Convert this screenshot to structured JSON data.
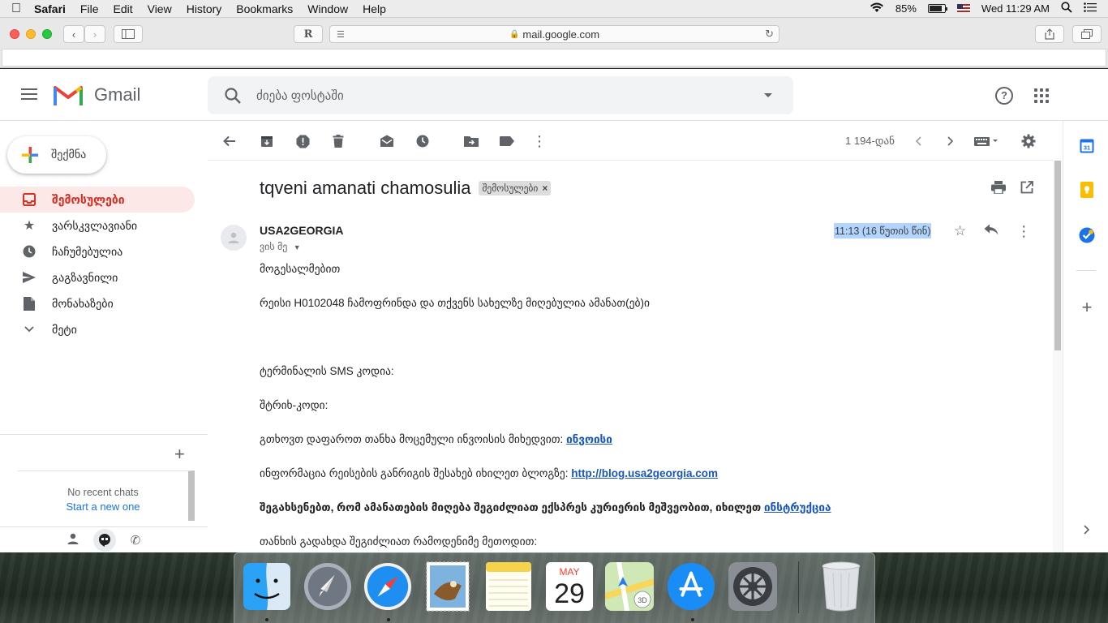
{
  "menubar": {
    "app": "Safari",
    "items": [
      "File",
      "Edit",
      "View",
      "History",
      "Bookmarks",
      "Window",
      "Help"
    ],
    "battery": "85%",
    "clock": "Wed 11:29 AM"
  },
  "safari": {
    "url": "mail.google.com",
    "reader_label": "R"
  },
  "gmail": {
    "logo_text": "Gmail",
    "search_placeholder": "ძიება ფოსტაში",
    "compose_label": "შექმნა",
    "nav": [
      {
        "label": "შემოსულები",
        "icon": "inbox-icon",
        "active": true
      },
      {
        "label": "ვარსკვლავიანი",
        "icon": "star-icon"
      },
      {
        "label": "ჩაჩუმებულია",
        "icon": "clock-icon"
      },
      {
        "label": "გაგზავნილი",
        "icon": "send-icon"
      },
      {
        "label": "მონახაზები",
        "icon": "draft-icon"
      },
      {
        "label": "მეტი",
        "icon": "chevron-down-icon"
      }
    ],
    "chat": {
      "no_recent": "No recent chats",
      "start_new": "Start a new one"
    },
    "pagination": "1 194-დან",
    "email": {
      "subject": "tqveni amanati chamosulia",
      "label_chip": "შემოსულები",
      "sender": "USA2GEORGIA",
      "to": "ვის მე",
      "time": "11:13 (16 წუთის წინ)",
      "lines": {
        "greeting": "მოგესალმებით",
        "flight": "რეისი H0102048 ჩამოფრინდა და თქვენს სახელზე მიღებულია ამანათ(ებ)ი",
        "sms": "ტერმინალის SMS კოდია:",
        "barcode": "შტრიხ-კოდი:",
        "invoice_text": "გთხოვთ დაფაროთ თანხა მოცემული ინვოისის მიხედვით: ",
        "invoice_link": "ინვოისი",
        "info_text": "ინფორმაცია რეისების განრიგის შესახებ იხილეთ ბლოგზე: ",
        "info_link": "http://blog.usa2georgia.com",
        "courier_text": "შეგახსენებთ, რომ ამანათების მიღება შეგიძლიათ ექსპრეს კურიერის მეშვეობით, იხილეთ ",
        "courier_link": "ინსტრუქცია",
        "payment": "თანხის გადახდა შეგიძლიათ რამოდენიმე მეთოდით:"
      }
    },
    "calendar_day": "31"
  },
  "dock": {
    "calendar_month": "MAY",
    "calendar_day": "29"
  },
  "colors": {
    "gmail_red": "#d93025",
    "active_bg": "#fce8e6",
    "link": "#1a56b8",
    "selection": "#b3d4fc"
  }
}
